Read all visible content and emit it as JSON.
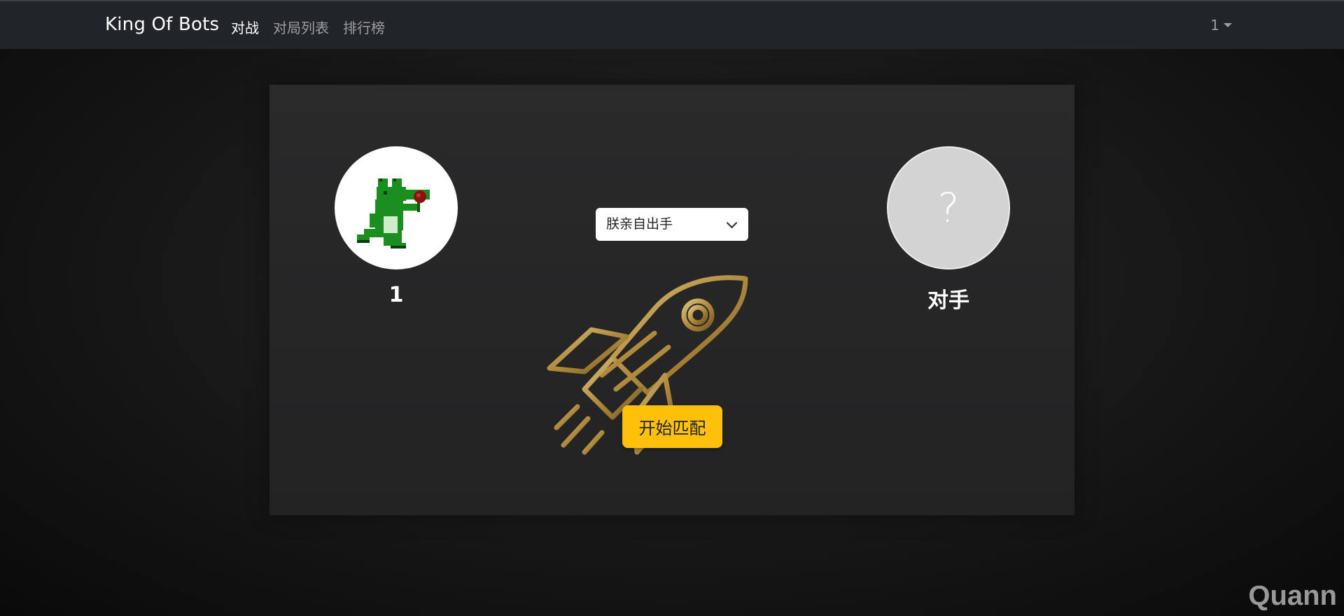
{
  "navbar": {
    "brand": "King Of Bots",
    "links": [
      {
        "label": "对战",
        "active": true
      },
      {
        "label": "对局列表",
        "active": false
      },
      {
        "label": "排行榜",
        "active": false
      }
    ],
    "user": "1"
  },
  "match": {
    "me": {
      "name": "1",
      "avatar_icon": "pixel-crocodile-with-rose"
    },
    "opponent": {
      "name": "对手",
      "avatar_placeholder": "?"
    },
    "bot_select": {
      "selected": "朕亲自出手"
    },
    "start_button_label": "开始匹配",
    "background_icon": "rocket-icon"
  },
  "colors": {
    "navbar_bg": "#212529",
    "accent_button": "#ffc107",
    "opponent_avatar_bg": "#d3d3d3"
  },
  "watermark": "Quann"
}
